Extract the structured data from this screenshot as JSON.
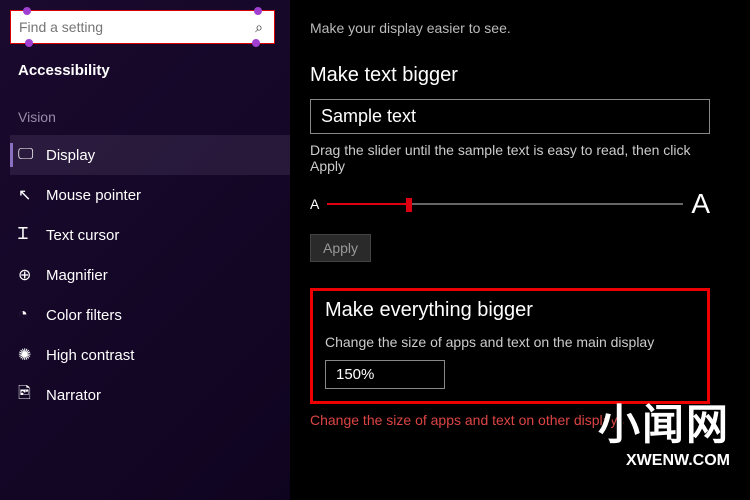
{
  "search": {
    "placeholder": "Find a setting"
  },
  "sidebar": {
    "title": "Accessibility",
    "group": "Vision",
    "items": [
      {
        "label": "Display"
      },
      {
        "label": "Mouse pointer"
      },
      {
        "label": "Text cursor"
      },
      {
        "label": "Magnifier"
      },
      {
        "label": "Color filters"
      },
      {
        "label": "High contrast"
      },
      {
        "label": "Narrator"
      }
    ]
  },
  "main": {
    "subtitle": "Make your display easier to see.",
    "text_bigger": {
      "heading": "Make text bigger",
      "sample": "Sample text",
      "hint": "Drag the slider until the sample text is easy to read, then click Apply",
      "small_a": "A",
      "large_a": "A",
      "apply": "Apply"
    },
    "everything_bigger": {
      "heading": "Make everything bigger",
      "desc": "Change the size of apps and text on the main display",
      "value": "150%",
      "note": "Change the size of apps and text on other displays"
    }
  },
  "watermark": {
    "big": "小闻网",
    "small": "XWENW.COM"
  }
}
